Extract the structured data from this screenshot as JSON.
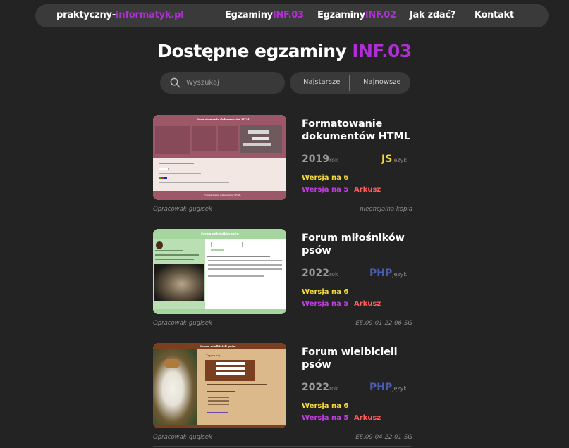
{
  "nav": {
    "brand_main": "praktyczny-",
    "brand_accent": "informatyk.pl",
    "links": [
      {
        "main": "Egzaminy",
        "accent": "INF.03"
      },
      {
        "main": "Egzaminy",
        "accent": "INF.02"
      },
      {
        "main": "Jak zdać?",
        "accent": ""
      },
      {
        "main": "Kontakt",
        "accent": ""
      }
    ]
  },
  "page": {
    "title_main": "Dostępne egzaminy",
    "title_accent": "INF.03"
  },
  "search": {
    "placeholder": "Wyszukaj"
  },
  "sort": {
    "oldest": "Najstarsze",
    "newest": "Najnowsze"
  },
  "cards": [
    {
      "title": "Formatowanie dokumentów HTML",
      "year": "2019",
      "year_unit": "rok",
      "lang": "JS",
      "lang_unit": "język",
      "lang_color": "#f2da3a",
      "v6": "Wersja na 6",
      "v5": "Wersja na 5",
      "sheet": "Arkusz",
      "author": "Opracował: gugisek",
      "code": "nieoficjalna kopia"
    },
    {
      "title": "Forum miłośników psów",
      "year": "2022",
      "year_unit": "rok",
      "lang": "PHP",
      "lang_unit": "język",
      "lang_color": "#4a5bb0",
      "v6": "Wersja na 6",
      "v5": "Wersja na 5",
      "sheet": "Arkusz",
      "author": "Opracował: gugisek",
      "code": "EE.09-01-22.06-SG"
    },
    {
      "title": "Forum wielbicieli psów",
      "year": "2022",
      "year_unit": "rok",
      "lang": "PHP",
      "lang_unit": "język",
      "lang_color": "#4a5bb0",
      "v6": "Wersja na 6",
      "v5": "Wersja na 5",
      "sheet": "Arkusz",
      "author": "Opracował: gugisek",
      "code": "EE.09-04-22.01-SG"
    }
  ],
  "thumbs": {
    "t1_title": "Formatowanie dokumentów HTML",
    "t1_footer": "Formatowanie dokumentów HTML",
    "t2_title": "Forum miłośników psów",
    "t3_title": "Forum wielbicieli psów",
    "t3_form": "Zapisz się"
  },
  "colors": {
    "accent": "#b12ed6",
    "background": "#232323",
    "nav_bg": "#3a3a3a",
    "version6": "#f2da3a",
    "version5": "#c23ee0",
    "sheet": "#ff5c5c"
  }
}
